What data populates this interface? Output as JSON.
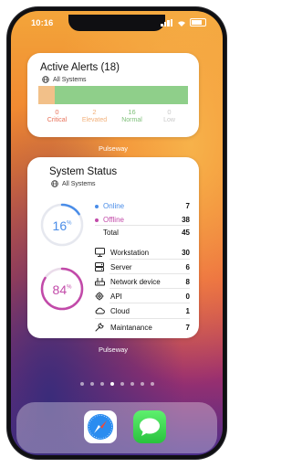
{
  "status_bar": {
    "time": "10:16"
  },
  "alerts_widget": {
    "title": "Active Alerts (18)",
    "subtitle": "All Systems",
    "segments": [
      {
        "label": "Critical",
        "count": "0",
        "color": "#f2c089",
        "text_color": "#e8725a"
      },
      {
        "label": "Elevated",
        "count": "2",
        "color": "#8fcf8a",
        "text_color": "#f2b07a"
      },
      {
        "label": "Normal",
        "count": "16",
        "color": "#8fcf8a",
        "text_color": "#7fc07a"
      },
      {
        "label": "Low",
        "count": "0",
        "color": "#8fcf8a",
        "text_color": "#c9c9c9"
      }
    ],
    "footer": "Pulseway"
  },
  "status_widget": {
    "title": "System Status",
    "subtitle": "All Systems",
    "online_percent": {
      "value": 16,
      "label": "16",
      "unit": "%"
    },
    "offline_percent": {
      "value": 84,
      "label": "84",
      "unit": "%"
    },
    "online": {
      "label": "Online",
      "value": "7"
    },
    "offline": {
      "label": "Offline",
      "value": "38"
    },
    "total": {
      "label": "Total",
      "value": "45"
    },
    "categories": [
      {
        "icon": "monitor-icon",
        "label": "Workstation",
        "value": "30"
      },
      {
        "icon": "server-icon",
        "label": "Server",
        "value": "6"
      },
      {
        "icon": "network-device-icon",
        "label": "Network device",
        "value": "8"
      },
      {
        "icon": "api-icon",
        "label": "API",
        "value": "0"
      },
      {
        "icon": "cloud-icon",
        "label": "Cloud",
        "value": "1"
      },
      {
        "icon": "wrench-icon",
        "label": "Maintanance",
        "value": "7"
      }
    ],
    "footer": "Pulseway",
    "colors": {
      "online": "#4a8de8",
      "offline": "#c24aa9"
    }
  },
  "dock": {
    "apps": [
      "Safari",
      "Messages"
    ]
  }
}
